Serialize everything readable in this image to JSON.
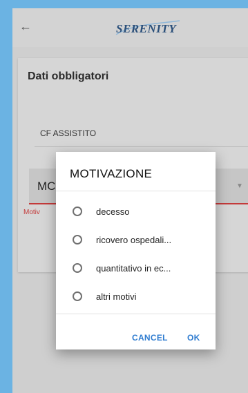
{
  "app": {
    "logo": "SERENITY"
  },
  "form": {
    "section_title": "Dati obbligatori",
    "cf_label": "CF ASSISTITO",
    "select_text": "MC",
    "error_text": "Motiv"
  },
  "dialog": {
    "title": "MOTIVAZIONE",
    "options": [
      {
        "label": "decesso"
      },
      {
        "label": "ricovero ospedali..."
      },
      {
        "label": "quantitativo in ec..."
      },
      {
        "label": "altri motivi"
      }
    ],
    "cancel_label": "CANCEL",
    "ok_label": "OK"
  }
}
